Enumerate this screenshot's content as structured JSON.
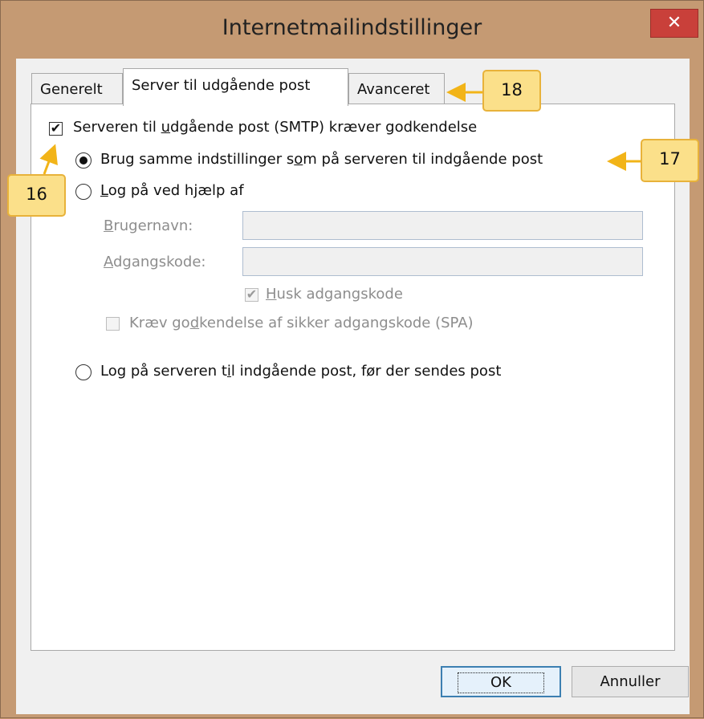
{
  "window": {
    "title": "Internetmailindstillinger",
    "close_glyph": "✕"
  },
  "tabs": [
    {
      "label": "Generelt"
    },
    {
      "label": "Server til udgående post"
    },
    {
      "label": "Avanceret"
    }
  ],
  "smtp_auth": {
    "label_pre": "Serveren til ",
    "label_u": "u",
    "label_post": "dgående post (SMTP) kræver godkendelse",
    "checked": true
  },
  "radio_same": {
    "label_pre": "Brug samme indstillinger s",
    "label_u": "o",
    "label_post": "m på serveren til indgående post",
    "selected": true
  },
  "radio_logon": {
    "label_pre": "",
    "label_u": "L",
    "label_post": "og på ved hjælp af",
    "selected": false
  },
  "username": {
    "label_u": "B",
    "label_post": "rugernavn:",
    "value": ""
  },
  "password": {
    "label_u": "A",
    "label_post": "dgangskode:",
    "value": ""
  },
  "remember": {
    "label_u": "H",
    "label_post": "usk adgangskode",
    "checked": true
  },
  "spa": {
    "label_pre": "Kræv go",
    "label_u": "d",
    "label_post": "kendelse af sikker adgangskode (SPA)",
    "checked": false
  },
  "radio_before": {
    "label_pre": "Log på serveren t",
    "label_u": "i",
    "label_post": "l indgående post, før der sendes post",
    "selected": false
  },
  "buttons": {
    "ok": "OK",
    "cancel": "Annuller"
  },
  "callouts": {
    "c16": "16",
    "c17": "17",
    "c18": "18"
  },
  "colors": {
    "callout_fill": "#fbe08a",
    "callout_border": "#e8b23a",
    "arrow": "#f2b418",
    "close": "#c9403a"
  }
}
